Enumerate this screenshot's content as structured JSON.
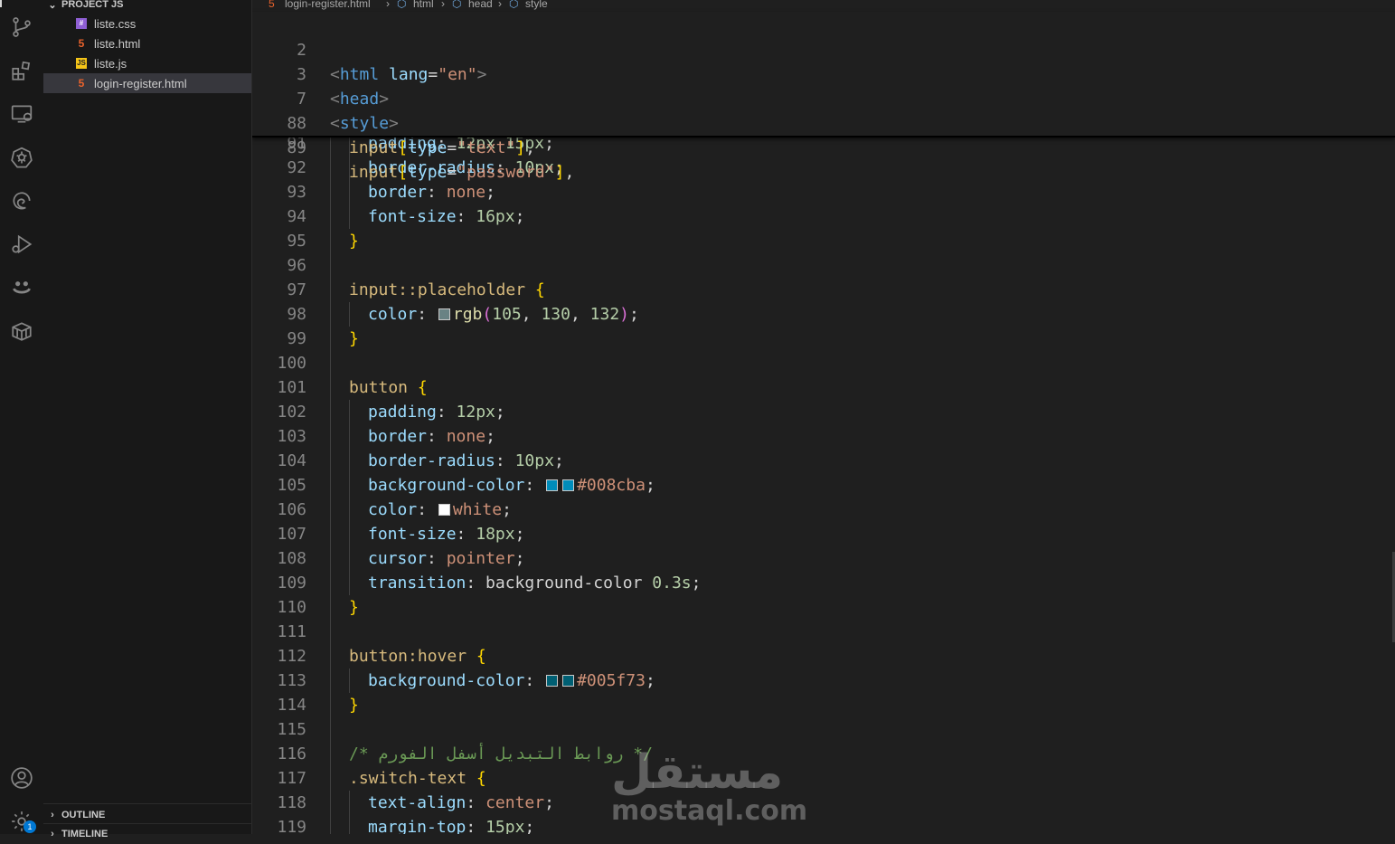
{
  "explorer": {
    "project_title": "PROJECT JS",
    "files": [
      {
        "name": "liste.css",
        "icon": "css-file-icon",
        "color": "#8f5fd4",
        "active": false
      },
      {
        "name": "liste.html",
        "icon": "html-file-icon",
        "color": "#e8622c",
        "active": false
      },
      {
        "name": "liste.js",
        "icon": "js-file-icon",
        "color": "#f5c518",
        "active": false
      },
      {
        "name": "login-register.html",
        "icon": "html-file-icon",
        "color": "#e8622c",
        "active": true
      }
    ],
    "outline_label": "OUTLINE",
    "timeline_label": "TIMELINE"
  },
  "activity_bar": {
    "icons": [
      "source-control-icon",
      "extensions-icon",
      "remote-explorer-icon",
      "kubernetes-icon",
      "edge-devtools-icon",
      "run-debug-icon",
      "smiley-icon",
      "package-icon",
      "account-icon",
      "settings-gear-icon"
    ],
    "settings_badge": "1"
  },
  "breadcrumb": [
    "login-register.html",
    "html",
    "head",
    "style"
  ],
  "sticky_lines": [
    {
      "n": "2",
      "text": "<html lang=\"en\">"
    },
    {
      "n": "3",
      "text": "<head>"
    },
    {
      "n": "7",
      "text": "<style>"
    },
    {
      "n": "88",
      "text": "input[type=\"text\"],"
    },
    {
      "n": "89",
      "text": "input[type=\"password\"],"
    }
  ],
  "code_lines": [
    {
      "n": "91",
      "text": "padding: 12px 15px;"
    },
    {
      "n": "92",
      "text": "border-radius: 10px;"
    },
    {
      "n": "93",
      "text": "border: none;"
    },
    {
      "n": "94",
      "text": "font-size: 16px;"
    },
    {
      "n": "95",
      "text": "}"
    },
    {
      "n": "96",
      "text": ""
    },
    {
      "n": "97",
      "text": "input::placeholder {"
    },
    {
      "n": "98",
      "text": "color: rgb(105, 130, 132);"
    },
    {
      "n": "99",
      "text": "}"
    },
    {
      "n": "100",
      "text": ""
    },
    {
      "n": "101",
      "text": "button {"
    },
    {
      "n": "102",
      "text": "padding: 12px;"
    },
    {
      "n": "103",
      "text": "border: none;"
    },
    {
      "n": "104",
      "text": "border-radius: 10px;"
    },
    {
      "n": "105",
      "text": "background-color: #008cba;"
    },
    {
      "n": "106",
      "text": "color: white;"
    },
    {
      "n": "107",
      "text": "font-size: 18px;"
    },
    {
      "n": "108",
      "text": "cursor: pointer;"
    },
    {
      "n": "109",
      "text": "transition: background-color 0.3s;"
    },
    {
      "n": "110",
      "text": "}"
    },
    {
      "n": "111",
      "text": ""
    },
    {
      "n": "112",
      "text": "button:hover {"
    },
    {
      "n": "113",
      "text": "background-color: #005f73;"
    },
    {
      "n": "114",
      "text": "}"
    },
    {
      "n": "115",
      "text": ""
    },
    {
      "n": "116",
      "text": "/* روابط التبديل أسفل الفورم */"
    },
    {
      "n": "117",
      "text": ".switch-text {"
    },
    {
      "n": "118",
      "text": "text-align: center;"
    },
    {
      "n": "119",
      "text": "margin-top: 15px;"
    }
  ],
  "swatch_colors": {
    "placeholder": "#698284",
    "button": "#008cba",
    "white": "#ffffff",
    "hover": "#005f73"
  },
  "watermark": {
    "arabic": "مستقل",
    "latin": "mostaql.com"
  }
}
